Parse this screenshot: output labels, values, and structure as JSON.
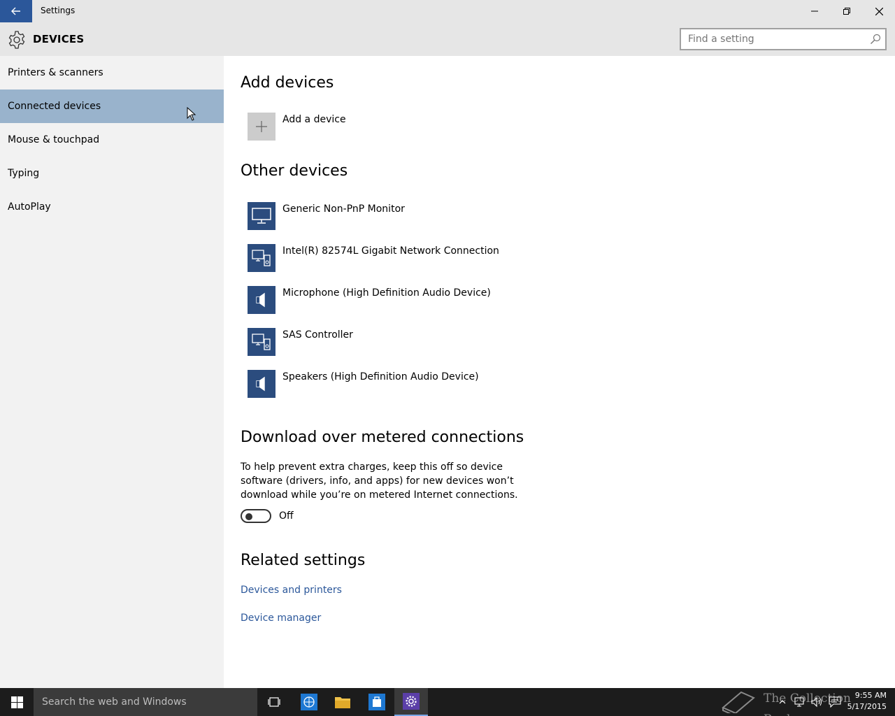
{
  "window": {
    "title": "Settings"
  },
  "header": {
    "section_title": "DEVICES",
    "search_placeholder": "Find a setting",
    "section_icon": "gear-icon"
  },
  "sidebar": {
    "items": [
      {
        "label": "Printers & scanners",
        "selected": false
      },
      {
        "label": "Connected devices",
        "selected": true
      },
      {
        "label": "Mouse & touchpad",
        "selected": false
      },
      {
        "label": "Typing",
        "selected": false
      },
      {
        "label": "AutoPlay",
        "selected": false
      }
    ]
  },
  "main": {
    "add_devices": {
      "heading": "Add devices",
      "add_label": "Add a device"
    },
    "other_devices": {
      "heading": "Other devices",
      "devices": [
        {
          "name": "Generic Non-PnP Monitor",
          "icon": "monitor-icon"
        },
        {
          "name": "Intel(R) 82574L Gigabit Network Connection",
          "icon": "generic-device-icon"
        },
        {
          "name": "Microphone (High Definition Audio Device)",
          "icon": "speaker-icon"
        },
        {
          "name": "SAS Controller",
          "icon": "generic-device-icon"
        },
        {
          "name": "Speakers (High Definition Audio Device)",
          "icon": "speaker-icon"
        }
      ]
    },
    "metered": {
      "heading": "Download over metered connections",
      "description": "To help prevent extra charges, keep this off so device software (drivers, info, and apps) for new devices won’t download while you’re on metered Internet connections.",
      "toggle_state": "Off"
    },
    "related": {
      "heading": "Related settings",
      "links": [
        "Devices and printers",
        "Device manager"
      ]
    }
  },
  "taskbar": {
    "search_placeholder": "Search the web and Windows",
    "watermark": "The Collection Book",
    "time": "9:55 AM",
    "date": "5/17/2015"
  },
  "colors": {
    "accent": "#2b579a",
    "selected_nav": "#99b3cc",
    "device_tile": "#2b4c7e"
  }
}
